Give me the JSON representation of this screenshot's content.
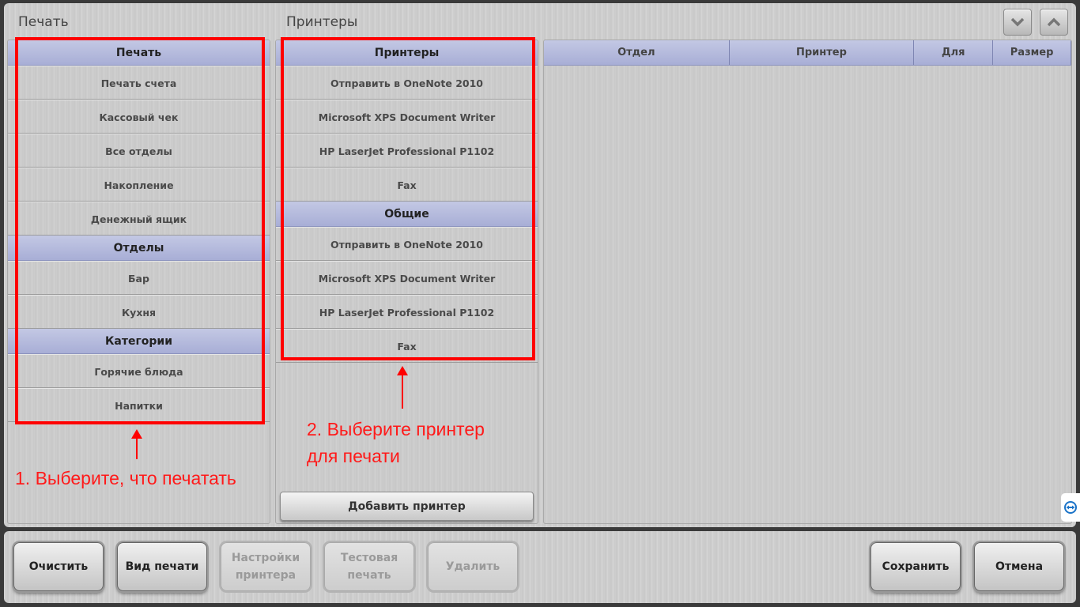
{
  "print_panel": {
    "title": "Печать",
    "groups": [
      {
        "header": "Печать",
        "items": [
          "Печать счета",
          "Кассовый чек",
          "Все отделы",
          "Накопление",
          "Денежный ящик"
        ]
      },
      {
        "header": "Отделы",
        "items": [
          "Бар",
          "Кухня"
        ]
      },
      {
        "header": "Категории",
        "items": [
          "Горячие блюда",
          "Напитки"
        ]
      }
    ]
  },
  "printers_panel": {
    "title": "Принтеры",
    "groups": [
      {
        "header": "Принтеры",
        "items": [
          "Отправить в OneNote 2010",
          "Microsoft XPS Document Writer",
          "HP LaserJet Professional P1102",
          "Fax"
        ]
      },
      {
        "header": "Общие",
        "items": [
          "Отправить в OneNote 2010",
          "Microsoft XPS Document Writer",
          "HP LaserJet Professional P1102",
          "Fax"
        ]
      }
    ],
    "add_button": "Добавить принтер"
  },
  "table": {
    "columns": [
      "Отдел",
      "Принтер",
      "Для",
      "Размер"
    ]
  },
  "annotations": {
    "step1": "1. Выберите, что печатать",
    "step2_line1": "2. Выберите принтер",
    "step2_line2": "для печати"
  },
  "bottom_buttons": {
    "clear": "Очистить",
    "print_view": "Вид печати",
    "printer_settings": "Настройки\nпринтера",
    "test_print": "Тестовая\nпечать",
    "delete": "Удалить",
    "save": "Сохранить",
    "cancel": "Отмена"
  },
  "colors": {
    "group_header": "#b3b8dc",
    "annotation_red": "#ff0000"
  }
}
